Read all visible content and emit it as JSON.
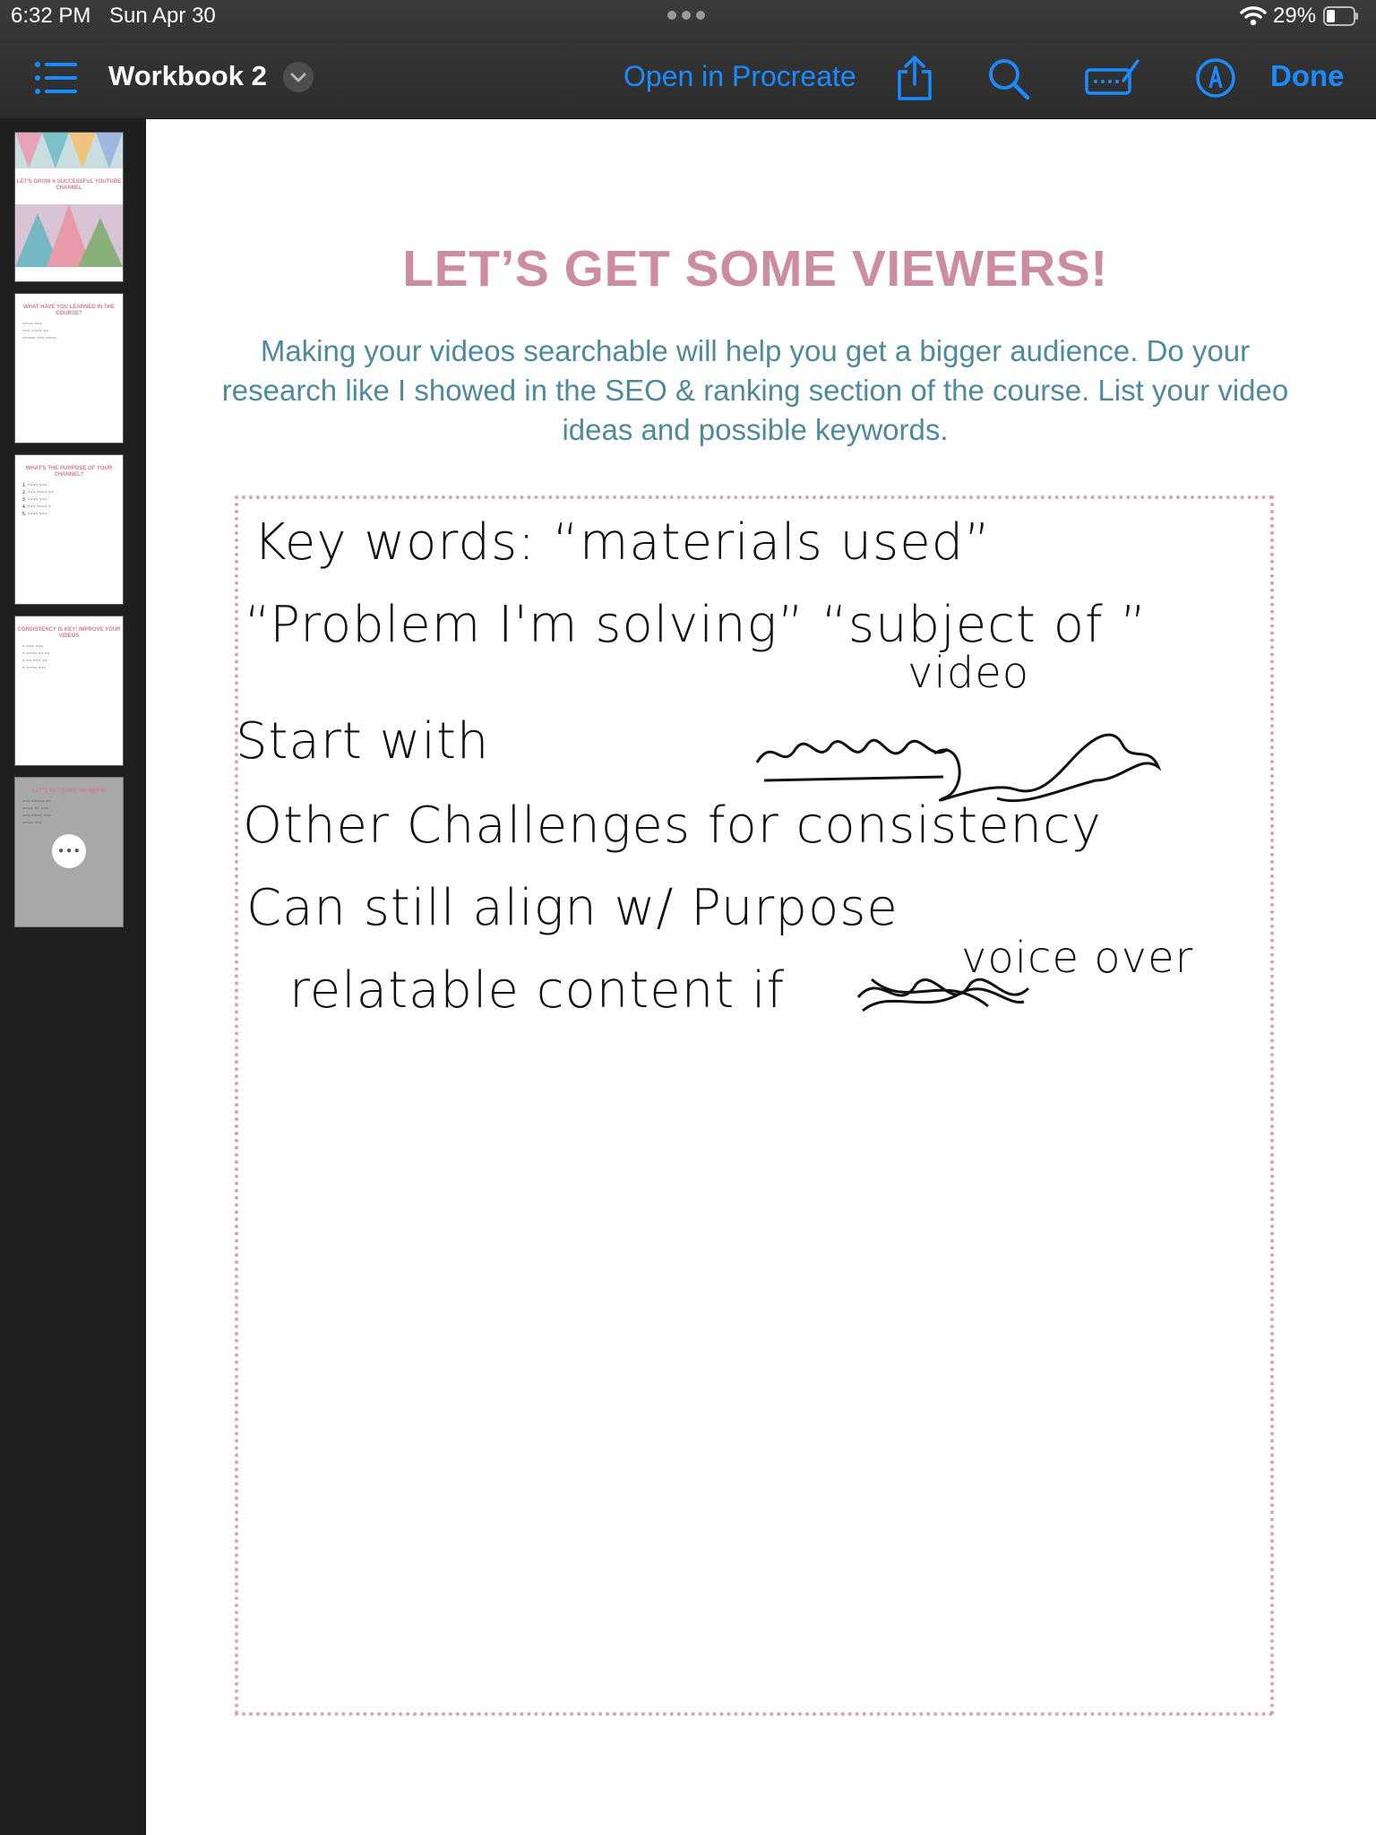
{
  "status_bar": {
    "time": "6:32 PM",
    "date": "Sun Apr 30",
    "battery_percent": "29%",
    "icons": [
      "more-dots-icon",
      "wifi-icon",
      "battery-icon"
    ]
  },
  "toolbar": {
    "document_title": "Workbook 2",
    "open_in_app_label": "Open in Procreate",
    "done_label": "Done",
    "accent_color": "#1a8cff",
    "icons": [
      "list-icon",
      "chevron-down-icon",
      "share-icon",
      "search-icon",
      "keyboard-icon",
      "markup-pen-icon"
    ]
  },
  "sidebar": {
    "thumbnails": [
      {
        "title": "LET'S GROW A SUCCESSFUL YOUTUBE CHANNEL",
        "selected": false
      },
      {
        "title": "WHAT HAVE YOU LEARNED IN THE COURSE?",
        "selected": false
      },
      {
        "title": "WHAT'S THE PURPOSE OF YOUR CHANNEL?",
        "selected": false
      },
      {
        "title": "CONSISTENCY IS KEY! IMPROVE YOUR VIDEOS",
        "selected": false
      },
      {
        "title": "LET'S GET SOME VIEWERS!",
        "selected": true
      }
    ]
  },
  "page": {
    "heading": "LET’S GET SOME VIEWERS!",
    "subtitle": "Making your videos searchable will help you get a bigger audience. Do your research like I showed in the SEO & ranking section of the course. List your video ideas and possible keywords.",
    "heading_color": "#cc8da3",
    "subtitle_color": "#4f8a9c",
    "box_border_color": "#d9a2b6",
    "handwritten_notes": {
      "line1": "Key words: “materials used”",
      "line2": "“Problem I'm solving” “subject of ”",
      "line2_insert": "video",
      "line3": "Start with",
      "line4": "Other Challenges for consistency",
      "line5": "Can still align w/ Purpose",
      "line6": "relatable content if",
      "line6_insert": "voice over"
    }
  }
}
